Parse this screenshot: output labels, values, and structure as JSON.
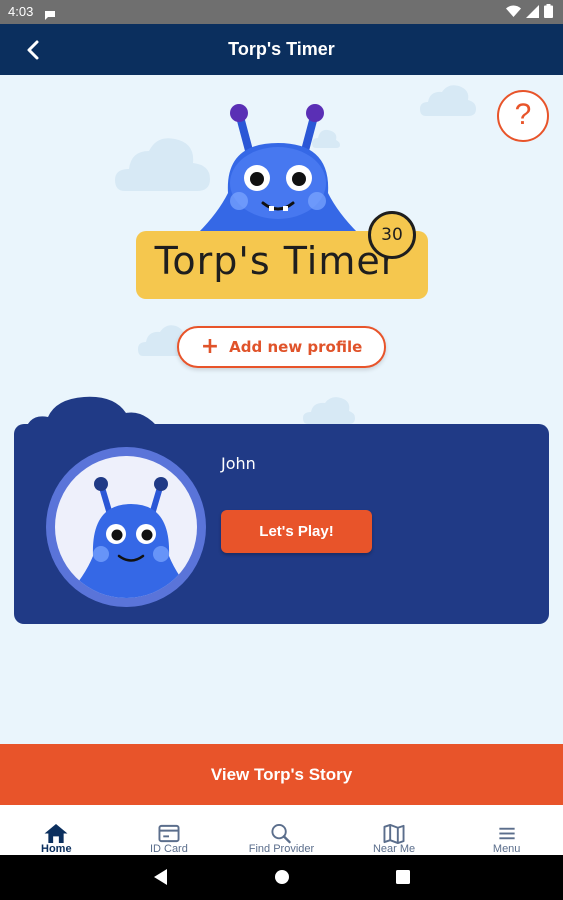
{
  "status_bar": {
    "time": "4:03"
  },
  "header": {
    "title": "Torp's Timer"
  },
  "logo": {
    "text": "Torp's Timer",
    "timer_value": "30"
  },
  "help": {
    "label": "?"
  },
  "add_profile": {
    "icon": "+",
    "label": "Add new profile"
  },
  "profiles": [
    {
      "name": "John",
      "play_label": "Let's Play!"
    }
  ],
  "story_button": {
    "label": "View Torp's Story"
  },
  "bottom_nav": [
    {
      "label": "Home",
      "icon": "home-icon",
      "active": true
    },
    {
      "label": "ID Card",
      "icon": "id-card-icon",
      "active": false
    },
    {
      "label": "Find Provider",
      "icon": "search-icon",
      "active": false
    },
    {
      "label": "Near Me",
      "icon": "map-icon",
      "active": false
    },
    {
      "label": "Menu",
      "icon": "menu-icon",
      "active": false
    }
  ],
  "colors": {
    "header": "#0b2f5e",
    "accent": "#e8542a",
    "card": "#203a86",
    "background": "#eaf5fc",
    "logo_banner": "#f5c74e"
  }
}
